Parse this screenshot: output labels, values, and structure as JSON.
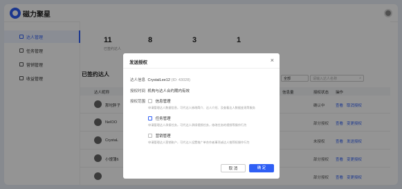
{
  "app": {
    "title": "磁力聚星"
  },
  "sidebar": {
    "items": [
      {
        "label": "达人管理",
        "icon": "user-icon",
        "active": true
      },
      {
        "label": "任务管理",
        "icon": "task-icon"
      },
      {
        "label": "营销管理",
        "icon": "marketing-icon"
      },
      {
        "label": "收益管理",
        "icon": "revenue-icon"
      }
    ]
  },
  "stats": [
    {
      "value": "11",
      "label": "已签约达人"
    },
    {
      "value": "8",
      "label": ""
    },
    {
      "value": "3",
      "label": ""
    },
    {
      "value": "1",
      "label": ""
    }
  ],
  "list": {
    "title": "已签约达人",
    "filter_value": "全部",
    "search_placeholder": "请输入达人名称",
    "columns": {
      "talent": "达人昵称",
      "info": "信息量",
      "status": "授权状态",
      "actions": "操作"
    },
    "rows": [
      {
        "name": "那坨胖子",
        "status": "确认中",
        "action1": "查看",
        "action2": "取消授权"
      },
      {
        "name": "NeIOO",
        "status": "部分授权",
        "action1": "查看",
        "action2": "变更授权"
      },
      {
        "name": "CrystaL",
        "status": "未授权",
        "action1": "查看",
        "action2": "发送授权"
      },
      {
        "name": "小馒蒲6",
        "status": "部分授权",
        "action1": "查看",
        "action2": "变更授权"
      },
      {
        "name": "",
        "status": "部分授权",
        "action1": "查看",
        "action2": "变更授权"
      }
    ]
  },
  "modal": {
    "title": "发送授权",
    "close": "×",
    "talent_label": "达人信息",
    "talent_name": "CrystalLee12",
    "talent_id": "(ID: 43028)",
    "time_label": "授权时间",
    "time_value": "机构与达人合约期内有效",
    "scope_label": "授权范围",
    "permissions": [
      {
        "name": "信息管理",
        "desc": "申请管理达人数据信息，可代达人修改简介、达人介绍、及查看达人数据变现等服务",
        "highlight": false
      },
      {
        "name": "任务管理",
        "desc": "申请管理达人承接任务，可代达人承接视频任务，修改任务的视频等操作行为",
        "highlight": true
      },
      {
        "name": "营销管理",
        "desc": "申请管理达人营销账户，可代达人设置推广单合作者事项或达人推荐权操作行为",
        "highlight": false
      }
    ],
    "cancel": "取 消",
    "confirm": "确 定"
  }
}
